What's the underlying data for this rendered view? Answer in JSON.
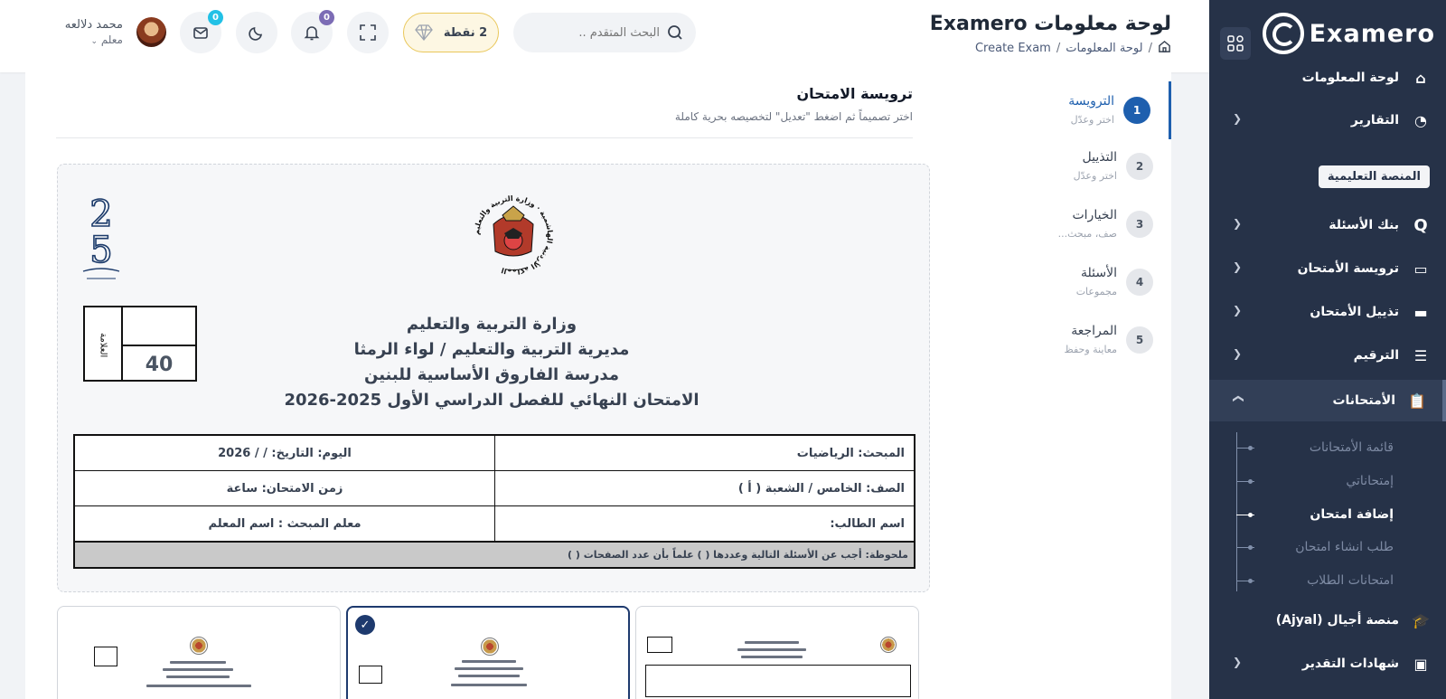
{
  "app": {
    "name": "Examero"
  },
  "header": {
    "title": "لوحة معلومات Examero",
    "breadcrumb": [
      "لوحة المعلومات",
      "Create Exam"
    ],
    "search_placeholder": "البحث المتقدم ..",
    "points_label": "2 نقطة",
    "notifications_count": "0",
    "messages_count": "0",
    "user_name": "محمد دلالعه",
    "user_role": "معلم"
  },
  "sidebar": {
    "top_item": "لوحة المعلومات",
    "reports": "التقارير",
    "section_label": "المنصة التعليمية",
    "items": [
      {
        "label": "بنك الأسئلة",
        "icon": "q-icon"
      },
      {
        "label": "ترويسة الأمتحان",
        "icon": "header-icon"
      },
      {
        "label": "تذييل الأمتحان",
        "icon": "footer-icon"
      },
      {
        "label": "الترقيم",
        "icon": "list-icon"
      },
      {
        "label": "الأمتحانات",
        "icon": "clipboard-icon"
      }
    ],
    "sub_items": [
      "قائمة الأمتحانات",
      "إمتحاناتي",
      "إضافة امتحان",
      "طلب انشاء امتحان",
      "امتحانات الطلاب"
    ],
    "bottom_items": [
      {
        "label": "منصة أجيال (Ajyal)",
        "icon": "graduation-cap-icon"
      },
      {
        "label": "شهادات التقدير",
        "icon": "certificate-icon"
      }
    ]
  },
  "steps": [
    {
      "num": "1",
      "title": "الترويسة",
      "sub": "اختر وعدّل"
    },
    {
      "num": "2",
      "title": "التذييل",
      "sub": "اختر وعدّل"
    },
    {
      "num": "3",
      "title": "الخيارات",
      "sub": "صف، مبحث..."
    },
    {
      "num": "4",
      "title": "الأسئلة",
      "sub": "مجموعات"
    },
    {
      "num": "5",
      "title": "المراجعة",
      "sub": "معاينة وحفظ"
    }
  ],
  "section": {
    "title": "ترويسة الامتحان",
    "subtitle": "اختر تصميماً ثم اضغط \"تعديل\" لتخصيصه بحرية كاملة"
  },
  "preview": {
    "emblem_text": "المملكة الأردنية الهاشمية · وزارة التربية والتعليم",
    "grade_label": "العلامة",
    "grade_value": "40",
    "school_lines": [
      "وزارة التربية والتعليم",
      "مديرية التربية والتعليم / لواء الرمثا",
      "مدرسة الفاروق الأساسية للبنين",
      "الامتحان النهائي للفصل الدراسي الأول 2025-2026"
    ],
    "table": {
      "subject": "المبحث: الرياضيات",
      "day_date": "اليوم:                التاريخ:   /   / 2026",
      "class": "الصف: الخامس              / الشعبة ( أ )",
      "duration": "زمن الامتحان: ساعة",
      "student": "اسم الطالب:",
      "teacher": "معلم المبحث : اسم المعلم",
      "note": "ملحوظة: أجب عن الأسئلة التالية وعددها (  ) علماً بأن عدد الصفحات (  )"
    }
  },
  "colors": {
    "sidebar_bg": "#263248",
    "accent": "#1e5fae",
    "points_border": "#e9c75a",
    "badge_cyan": "#22c1e6",
    "badge_purple": "#7c6cb5"
  }
}
